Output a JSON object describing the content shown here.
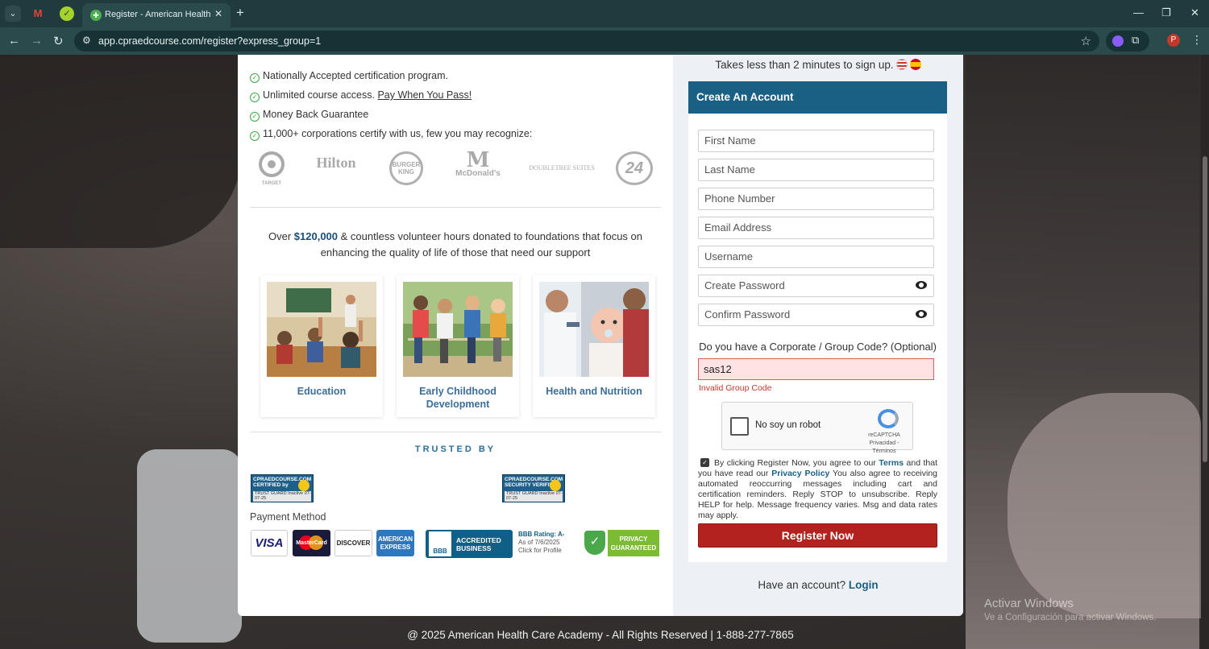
{
  "browser": {
    "tab_title": "Register - American Health Care",
    "url": "app.cpraedcourse.com/register?express_group=1",
    "profile_initial": "P"
  },
  "features": [
    {
      "text": "Nationally Accepted certification program."
    },
    {
      "text": "Unlimited course access.",
      "link": "Pay When You Pass!"
    },
    {
      "text": "Money Back Guarantee"
    },
    {
      "text": "11,000+ corporations certify with us, few you may recognize:"
    }
  ],
  "logos": [
    "TARGET",
    "Hilton",
    "BURGER KING",
    "McDonald's",
    "DOUBLETREE SUITES",
    "24"
  ],
  "donation": {
    "prefix": "Over",
    "amount": "$120,000",
    "suffix": "& countless volunteer hours donated to foundations that focus on enhancing the quality of life of those that need our support"
  },
  "causes": [
    {
      "label": "Education"
    },
    {
      "label": "Early Childhood Development"
    },
    {
      "label": "Health and Nutrition"
    }
  ],
  "trusted_by": "TRUSTED BY",
  "seals": [
    {
      "title": "CPRAEDCOURSE.COM CERTIFIED by",
      "guard": "TRUST GUARD",
      "status": "Inactive",
      "date": "07-07-25"
    },
    {
      "title": "CPRAEDCOURSE.COM SECURITY VERIFIED",
      "guard": "TRUST GUARD",
      "status": "Inactive",
      "date": "07-07-25"
    }
  ],
  "payment": {
    "label": "Payment Method",
    "cards": [
      "VISA",
      "MasterCard",
      "DISCOVER",
      "AMERICAN EXPRESS"
    ],
    "bbb_text": "ACCREDITED BUSINESS",
    "bbb_logo": "BBB",
    "bbb_rating": "BBB Rating: A-",
    "bbb_date": "As of 7/6/2025",
    "bbb_click": "Click for Profile",
    "privacy_badge": "PRIVACY GUARANTEED"
  },
  "signup": {
    "takes": "Takes less than 2 minutes to sign up.",
    "header": "Create An Account",
    "fields": [
      {
        "placeholder": "First Name"
      },
      {
        "placeholder": "Last Name"
      },
      {
        "placeholder": "Phone Number"
      },
      {
        "placeholder": "Email Address"
      },
      {
        "placeholder": "Username"
      },
      {
        "placeholder": "Create Password"
      },
      {
        "placeholder": "Confirm Password"
      }
    ],
    "group_question": "Do you have a Corporate / Group Code? (Optional)",
    "group_value": "sas12",
    "group_error": "Invalid Group Code",
    "captcha_label": "No soy un robot",
    "captcha_brand": "reCAPTCHA",
    "captcha_links": "Privacidad - Términos",
    "agree_start": "By clicking Register Now, you agree to our",
    "agree_terms": "Terms",
    "agree_mid": "and that you have read our",
    "agree_privacy": "Privacy Policy",
    "agree_end": "You also agree to receiving automated reoccurring messages including cart and certification reminders. Reply STOP to unsubscribe. Reply HELP for help. Message frequency varies. Msg and data rates may apply.",
    "register_button": "Register Now",
    "have_account": "Have an account?",
    "login_link": "Login"
  },
  "footer": "@ 2025 American Health Care Academy - All Rights Reserved | 1-888-277-7865",
  "windows_watermark": {
    "title": "Activar Windows",
    "subtitle": "Ve a Configuración para activar Windows."
  }
}
